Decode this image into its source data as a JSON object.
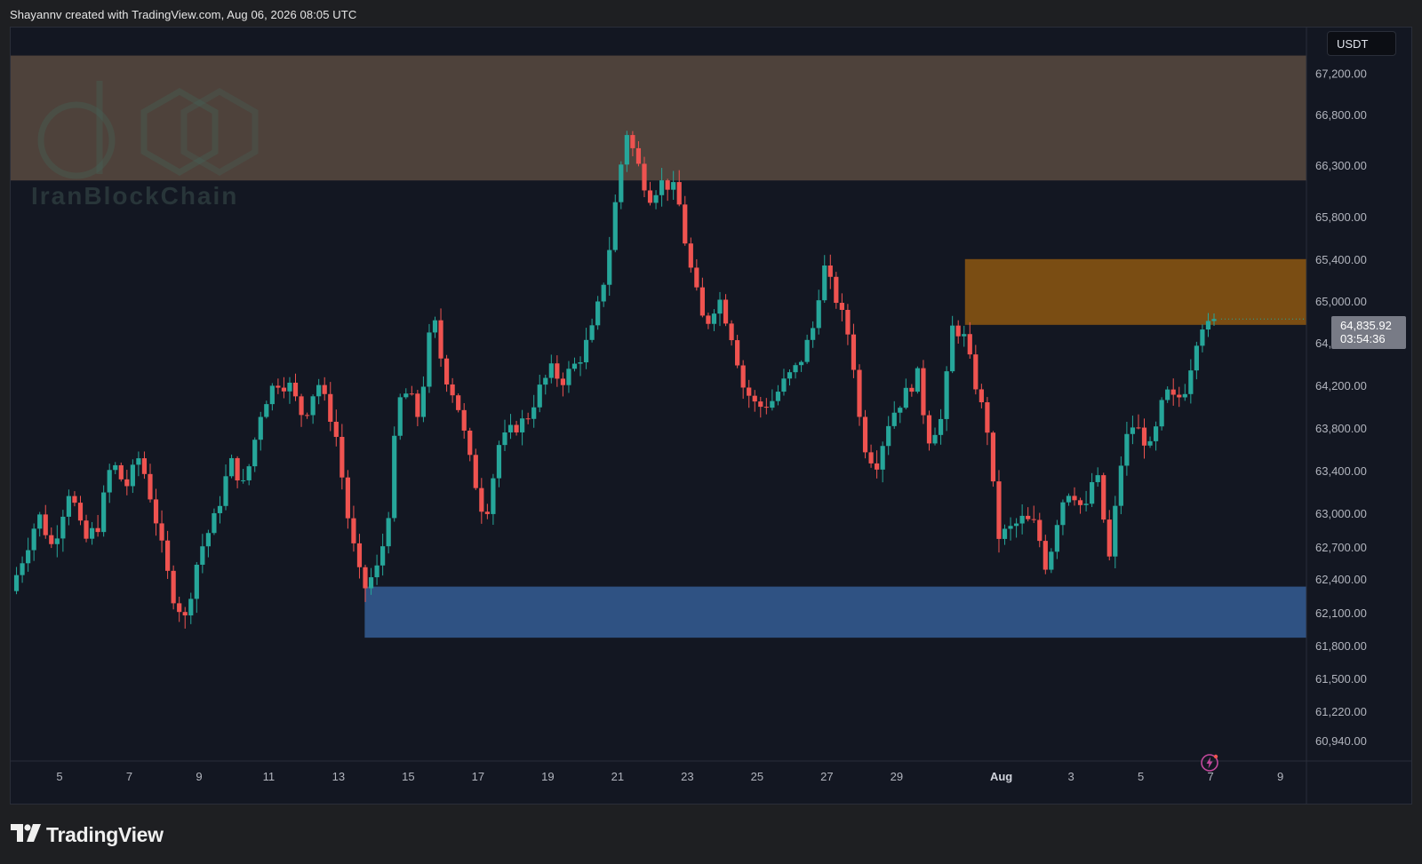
{
  "header": {
    "credit": "Shayannv created with TradingView.com, Aug 06, 2026 08:05 UTC"
  },
  "watermark": {
    "text": "IranBlockChain"
  },
  "currency": "USDT",
  "last_price": {
    "value": "64,835.92",
    "countdown": "03:54:36"
  },
  "footer": {
    "logo_text": "TradingView"
  },
  "icons": {
    "alert": "lightning-alert-icon",
    "logo": "tradingview-logo-icon"
  },
  "colors": {
    "up": "#26a69a",
    "down": "#ef5350",
    "supply_zone": "#4e423b",
    "order_block": "#7a4d13",
    "demand_zone": "#2f5283"
  },
  "chart_data": {
    "type": "candlestick",
    "title": "",
    "ylim": [
      60700,
      67520
    ],
    "y_ticks": [
      "67,200.00",
      "66,800.00",
      "66,300.00",
      "65,800.00",
      "65,400.00",
      "65,000.00",
      "64,600.00",
      "64,200.00",
      "63,800.00",
      "63,400.00",
      "63,000.00",
      "62,700.00",
      "62,400.00",
      "62,100.00",
      "61,800.00",
      "61,500.00",
      "61,220.00",
      "60,940.00"
    ],
    "y_tick_values": [
      67200,
      66800,
      66300,
      65800,
      65400,
      65000,
      64600,
      64200,
      63800,
      63400,
      63000,
      62700,
      62400,
      62100,
      61800,
      61500,
      61220,
      60940
    ],
    "x_ticks": [
      "5",
      "7",
      "9",
      "11",
      "13",
      "15",
      "17",
      "19",
      "21",
      "23",
      "25",
      "27",
      "29",
      "Aug",
      "3",
      "5",
      "7",
      "9"
    ],
    "x_tick_days": [
      5,
      7,
      9,
      11,
      13,
      15,
      17,
      19,
      21,
      23,
      25,
      27,
      29,
      32,
      34,
      36,
      38,
      40
    ],
    "bold_x_ticks": [
      "Aug"
    ],
    "x_range_days": [
      3.6,
      40.75
    ],
    "zones": [
      {
        "name": "supply-zone",
        "x0": 3.6,
        "x1": 40.75,
        "y0": 66160,
        "y1": 67380
      },
      {
        "name": "order-block-zone",
        "x0": 30.96,
        "x1": 40.75,
        "y0": 64780,
        "y1": 65410
      },
      {
        "name": "demand-zone",
        "x0": 13.75,
        "x1": 40.75,
        "y0": 61880,
        "y1": 62340
      }
    ],
    "anchors": [
      [
        3.6,
        62300
      ],
      [
        4.0,
        62650
      ],
      [
        4.4,
        63000
      ],
      [
        4.8,
        62700
      ],
      [
        5.3,
        63250
      ],
      [
        5.7,
        62750
      ],
      [
        6.1,
        62900
      ],
      [
        6.5,
        63500
      ],
      [
        6.9,
        63250
      ],
      [
        7.3,
        63550
      ],
      [
        7.7,
        63050
      ],
      [
        8.2,
        62300
      ],
      [
        8.6,
        62050
      ],
      [
        9.0,
        62650
      ],
      [
        9.5,
        63000
      ],
      [
        9.9,
        63500
      ],
      [
        10.3,
        63250
      ],
      [
        10.8,
        64000
      ],
      [
        11.2,
        64250
      ],
      [
        11.6,
        64200
      ],
      [
        12.0,
        63900
      ],
      [
        12.4,
        64250
      ],
      [
        12.9,
        63800
      ],
      [
        13.3,
        62900
      ],
      [
        13.7,
        62300
      ],
      [
        14.1,
        62500
      ],
      [
        14.4,
        62900
      ],
      [
        14.7,
        64050
      ],
      [
        15.0,
        64150
      ],
      [
        15.3,
        63900
      ],
      [
        15.7,
        64900
      ],
      [
        16.0,
        64350
      ],
      [
        16.4,
        64050
      ],
      [
        16.8,
        63450
      ],
      [
        17.2,
        62950
      ],
      [
        17.6,
        63650
      ],
      [
        18.0,
        63800
      ],
      [
        18.4,
        63900
      ],
      [
        18.8,
        64200
      ],
      [
        19.1,
        64350
      ],
      [
        19.4,
        64250
      ],
      [
        19.9,
        64450
      ],
      [
        20.3,
        64750
      ],
      [
        20.7,
        65350
      ],
      [
        21.0,
        66100
      ],
      [
        21.25,
        66650
      ],
      [
        21.5,
        66400
      ],
      [
        21.9,
        66000
      ],
      [
        22.3,
        66150
      ],
      [
        22.7,
        66050
      ],
      [
        23.0,
        65450
      ],
      [
        23.5,
        64750
      ],
      [
        23.9,
        65050
      ],
      [
        24.3,
        64650
      ],
      [
        24.6,
        64200
      ],
      [
        25.0,
        64000
      ],
      [
        25.4,
        64050
      ],
      [
        25.8,
        64250
      ],
      [
        26.2,
        64400
      ],
      [
        26.6,
        64750
      ],
      [
        26.9,
        65350
      ],
      [
        27.3,
        65000
      ],
      [
        27.7,
        64600
      ],
      [
        28.0,
        63700
      ],
      [
        28.4,
        63450
      ],
      [
        28.8,
        63900
      ],
      [
        29.2,
        64100
      ],
      [
        29.6,
        64300
      ],
      [
        29.9,
        63700
      ],
      [
        30.3,
        63900
      ],
      [
        30.6,
        64750
      ],
      [
        30.9,
        64700
      ],
      [
        31.2,
        64300
      ],
      [
        31.6,
        63800
      ],
      [
        31.9,
        62800
      ],
      [
        32.2,
        62850
      ],
      [
        32.6,
        62950
      ],
      [
        33.0,
        62900
      ],
      [
        33.3,
        62500
      ],
      [
        33.7,
        63100
      ],
      [
        34.0,
        63250
      ],
      [
        34.4,
        63000
      ],
      [
        34.7,
        63450
      ],
      [
        35.1,
        62600
      ],
      [
        35.5,
        63650
      ],
      [
        35.8,
        63850
      ],
      [
        36.3,
        63600
      ],
      [
        36.7,
        64150
      ],
      [
        37.0,
        64050
      ],
      [
        37.3,
        64200
      ],
      [
        37.7,
        64800
      ],
      [
        38.0,
        64750
      ],
      [
        38.2,
        64820
      ]
    ],
    "last_price_value": 64835.92
  }
}
